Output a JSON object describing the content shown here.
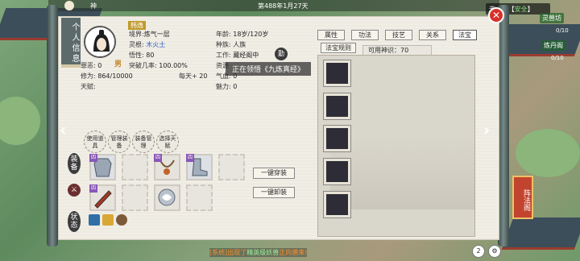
{
  "top": {
    "date": "第488年1月27天",
    "left_text": "神"
  },
  "location": {
    "name": "天...坛",
    "safe": "安全"
  },
  "map_labels": [
    "灵兽坊",
    "炼丹阁"
  ],
  "map_values": [
    "0/10",
    "0/10"
  ],
  "side_tab": "个人信息",
  "character": {
    "name": "韩逸",
    "gender": "男",
    "realm_label": "境界:",
    "realm": "炼气一层",
    "root_label": "灵根:",
    "root": "木火土",
    "comprehension_label": "悟性:",
    "comprehension": "80",
    "evil_label": "罪恶:",
    "evil": "0",
    "breakthrough_label": "突破几率:",
    "breakthrough": "100.00%",
    "cultivation_label": "修为:",
    "cultivation": "864/10000",
    "per_day_label": "每天+",
    "per_day": "20",
    "talent_label": "天赋:",
    "age_label": "年龄:",
    "age": "18岁/120岁",
    "race_label": "种族:",
    "race": "人族",
    "work_label": "工作:",
    "work": "藏经阁中",
    "work_badge": "勤",
    "resource_label": "资源",
    "qi_label": "气血:",
    "qi": "0",
    "charm_label": "魅力:",
    "charm": "0"
  },
  "tabs": [
    "属性",
    "功法",
    "技艺",
    "关系",
    "法宝"
  ],
  "active_tab": "法宝",
  "treasure_rule_btn": "法宝规则",
  "available_sense": "可用神识：70",
  "toast": "正在领悟《九炼真经》",
  "skill_buttons": [
    "使用道具",
    "管理装备",
    "装备管理",
    "选择天赋"
  ],
  "equip_label": "装备",
  "status_label": "状态",
  "one_key_wear": "一键穿装",
  "one_key_unwear": "一键卸装",
  "equip_tags": [
    "四",
    "四",
    "四",
    "四"
  ],
  "red_banner": "阵法阁",
  "chat": {
    "prefix": "[系统]",
    "mid": "出现了",
    "green": "精英级妖兽",
    "tail": "正向袭来!"
  },
  "mini_buttons": [
    "2"
  ],
  "colors": {
    "accent": "#c19a2c",
    "close": "#d9302a",
    "panel": "#f1eee6"
  }
}
